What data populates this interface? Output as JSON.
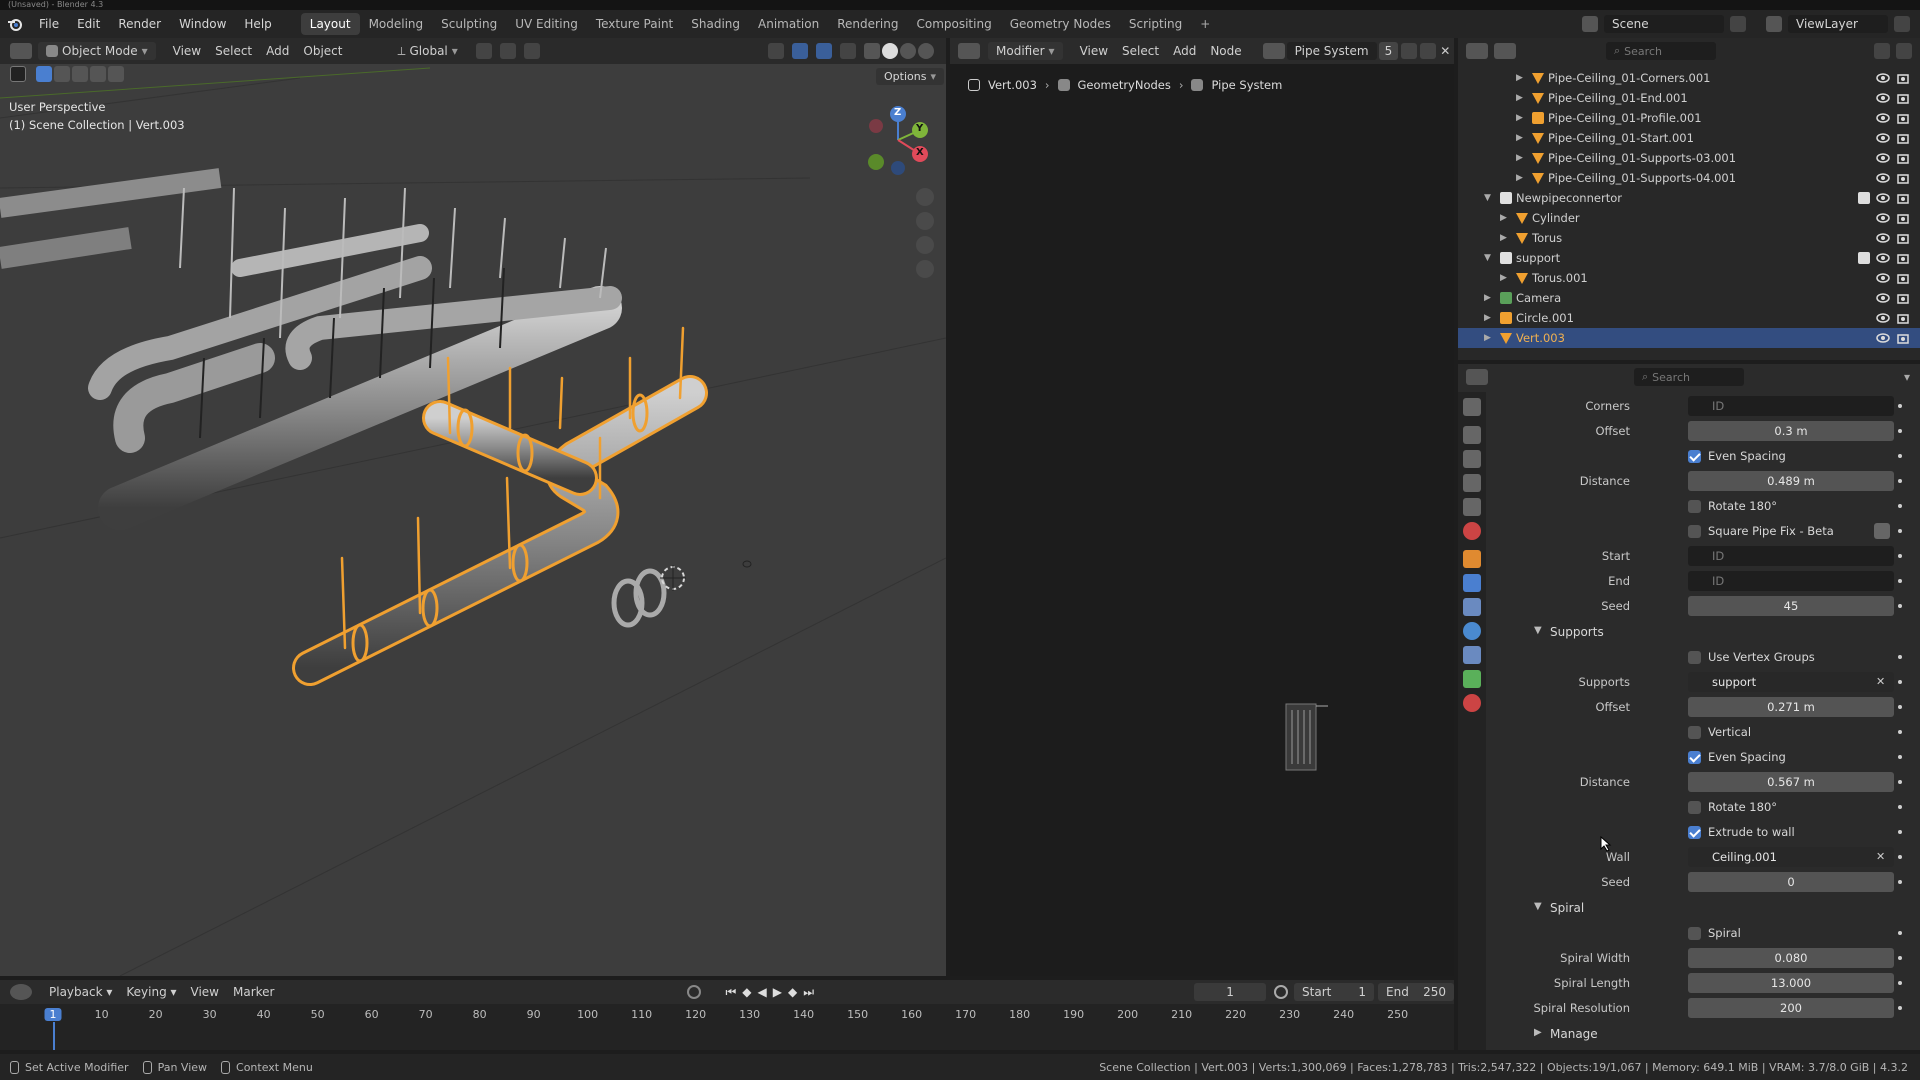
{
  "window_title": "(Unsaved) - Blender 4.3",
  "menubar": {
    "items": [
      "File",
      "Edit",
      "Render",
      "Window",
      "Help"
    ]
  },
  "workspaces": [
    {
      "label": "Layout",
      "active": true
    },
    {
      "label": "Modeling"
    },
    {
      "label": "Sculpting"
    },
    {
      "label": "UV Editing"
    },
    {
      "label": "Texture Paint"
    },
    {
      "label": "Shading"
    },
    {
      "label": "Animation"
    },
    {
      "label": "Rendering"
    },
    {
      "label": "Compositing"
    },
    {
      "label": "Geometry Nodes"
    },
    {
      "label": "Scripting"
    }
  ],
  "topright": {
    "scene": "Scene",
    "viewlayer": "ViewLayer"
  },
  "viewport": {
    "mode": "Object Mode",
    "menus": [
      "View",
      "Select",
      "Add",
      "Object"
    ],
    "orientation": "Global",
    "options": "Options",
    "info_line1": "User Perspective",
    "info_line2": "(1) Scene Collection | Vert.003",
    "gizmo": {
      "x": "X",
      "y": "Y",
      "z": "Z"
    }
  },
  "node_editor": {
    "type": "Modifier",
    "menus": [
      "View",
      "Select",
      "Add",
      "Node"
    ],
    "tree_name": "Pipe System",
    "users": "5",
    "breadcrumb": [
      "Vert.003",
      "GeometryNodes",
      "Pipe System"
    ]
  },
  "outliner": {
    "search_placeholder": "Search",
    "rows": [
      {
        "label": "Pipe-Ceiling_01-Corners.001",
        "indent": 3,
        "icon": "mesh"
      },
      {
        "label": "Pipe-Ceiling_01-End.001",
        "indent": 3,
        "icon": "mesh"
      },
      {
        "label": "Pipe-Ceiling_01-Profile.001",
        "indent": 3,
        "icon": "curve"
      },
      {
        "label": "Pipe-Ceiling_01-Start.001",
        "indent": 3,
        "icon": "mesh"
      },
      {
        "label": "Pipe-Ceiling_01-Supports-03.001",
        "indent": 3,
        "icon": "mesh"
      },
      {
        "label": "Pipe-Ceiling_01-Supports-04.001",
        "indent": 3,
        "icon": "mesh"
      },
      {
        "label": "Newpipeconnertor",
        "indent": 1,
        "icon": "collection",
        "expanded": true
      },
      {
        "label": "Cylinder",
        "indent": 2,
        "icon": "mesh"
      },
      {
        "label": "Torus",
        "indent": 2,
        "icon": "mesh"
      },
      {
        "label": "support",
        "indent": 1,
        "icon": "collection",
        "expanded": true
      },
      {
        "label": "Torus.001",
        "indent": 2,
        "icon": "mesh"
      },
      {
        "label": "Camera",
        "indent": 1,
        "icon": "camera"
      },
      {
        "label": "Circle.001",
        "indent": 1,
        "icon": "curve"
      },
      {
        "label": "Vert.003",
        "indent": 1,
        "icon": "mesh",
        "selected": true
      }
    ]
  },
  "properties": {
    "search_placeholder": "Search",
    "corners": {
      "label": "Corners",
      "value": "ID"
    },
    "offset1": {
      "label": "Offset",
      "value": "0.3 m"
    },
    "even_spacing1": "Even Spacing",
    "distance1": {
      "label": "Distance",
      "value": "0.489 m"
    },
    "rotate1": "Rotate 180°",
    "square_fix": "Square Pipe Fix - Beta",
    "start": {
      "label": "Start",
      "value": "ID"
    },
    "end": {
      "label": "End",
      "value": "ID"
    },
    "seed1": {
      "label": "Seed",
      "value": "45"
    },
    "supports_panel": "Supports",
    "use_vertex_groups": "Use Vertex Groups",
    "supports": {
      "label": "Supports",
      "value": "support"
    },
    "offset2": {
      "label": "Offset",
      "value": "0.271 m"
    },
    "vertical": "Vertical",
    "even_spacing2": "Even Spacing",
    "distance2": {
      "label": "Distance",
      "value": "0.567 m"
    },
    "rotate2": "Rotate 180°",
    "extrude": "Extrude to wall",
    "wall": {
      "label": "Wall",
      "value": "Ceiling.001"
    },
    "seed2": {
      "label": "Seed",
      "value": "0"
    },
    "spiral_panel": "Spiral",
    "spiral_chk": "Spiral",
    "spiral_width": {
      "label": "Spiral Width",
      "value": "0.080"
    },
    "spiral_length": {
      "label": "Spiral Length",
      "value": "13.000"
    },
    "spiral_res": {
      "label": "Spiral Resolution",
      "value": "200"
    },
    "manage_panel": "Manage"
  },
  "timeline": {
    "menus": [
      "Playback",
      "Keying",
      "View",
      "Marker"
    ],
    "current_frame": "1",
    "start_label": "Start",
    "start": "1",
    "end_label": "End",
    "end": "250",
    "ticks": [
      "1",
      "10",
      "20",
      "30",
      "40",
      "50",
      "60",
      "70",
      "80",
      "90",
      "100",
      "110",
      "120",
      "130",
      "140",
      "150",
      "160",
      "170",
      "180",
      "190",
      "200",
      "210",
      "220",
      "230",
      "240",
      "250"
    ]
  },
  "statusbar": {
    "left": [
      "Set Active Modifier",
      "Pan View",
      "Context Menu"
    ],
    "right": "Scene Collection | Vert.003 | Verts:1,300,069 | Faces:1,278,783 | Tris:2,547,322 | Objects:19/1,067 | Memory: 649.1 MiB | VRAM: 3.7/8.0 GiB | 4.3.2"
  },
  "colors": {
    "accent": "#4a7fd0",
    "selected_orange": "#f0a030",
    "selection_row": "#334d80"
  }
}
